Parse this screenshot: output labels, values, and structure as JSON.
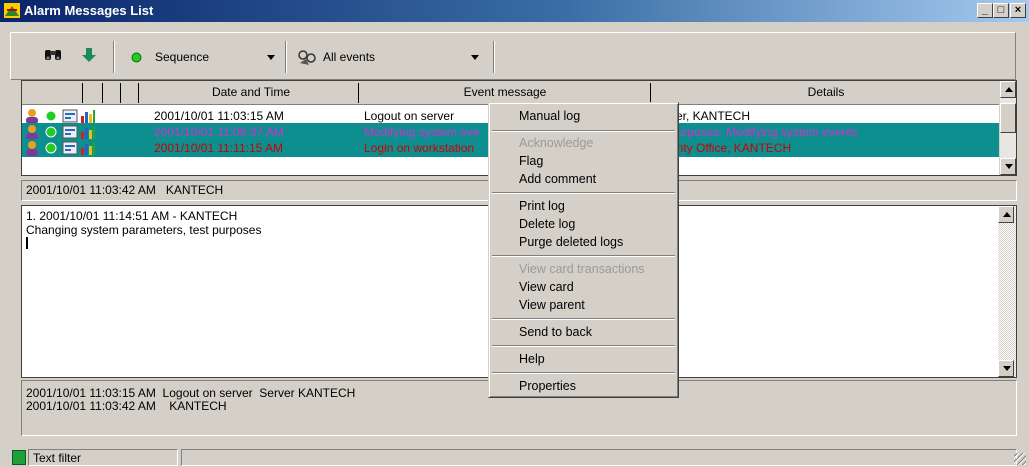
{
  "window": {
    "title": "Alarm Messages List",
    "minimize": "_",
    "maximize": "□",
    "close": "×"
  },
  "toolbar": {
    "find_icon": "binoculars-icon",
    "down_icon": "arrow-down-icon",
    "sort_combo": {
      "value": "Sequence",
      "icon": "green-dot-icon"
    },
    "filter_combo": {
      "value": "All events",
      "icon": "filter-icon"
    }
  },
  "grid": {
    "columns": [
      "Date and Time",
      "Event message",
      "Details"
    ],
    "rows": [
      {
        "date": "2001/10/01 11:03:15 AM",
        "message": "Logout on server",
        "details": "ver, KANTECH",
        "selected": false,
        "color": "#000000"
      },
      {
        "date": "2001/10/01 11:06:37 AM",
        "message": "Modifying system eve",
        "details": "purposes. Modifying system events",
        "selected": true,
        "color": "#cc33cc"
      },
      {
        "date": "2001/10/01 11:11:15 AM",
        "message": "Login on workstation",
        "details": "urity Office, KANTECH",
        "selected": true,
        "color": "#cc0000"
      }
    ]
  },
  "infobar": {
    "text": "2001/10/01 11:03:42 AM   KANTECH"
  },
  "editor": {
    "lines": [
      "1. 2001/10/01 11:14:51 AM - KANTECH",
      "Changing system parameters, test purposes"
    ]
  },
  "summary": {
    "lines": [
      "2001/10/01 11:03:15 AM  Logout on server  Server KANTECH",
      "2001/10/01 11:03:42 AM    KANTECH"
    ]
  },
  "statusbar": {
    "text_filter": "Text filter"
  },
  "context_menu": {
    "items": {
      "manual_log": "Manual log",
      "acknowledge": "Acknowledge",
      "flag": "Flag",
      "add_comment": "Add comment",
      "print_log": "Print log",
      "delete_log": "Delete log",
      "purge_deleted_logs": "Purge deleted logs",
      "view_card_transactions": "View card transactions",
      "view_card": "View card",
      "view_parent": "View parent",
      "send_to_back": "Send to back",
      "help": "Help",
      "properties": "Properties"
    }
  },
  "colors": {
    "selection": "#0e8f8f",
    "title_start": "#0a246a",
    "title_end": "#a6caf0"
  }
}
